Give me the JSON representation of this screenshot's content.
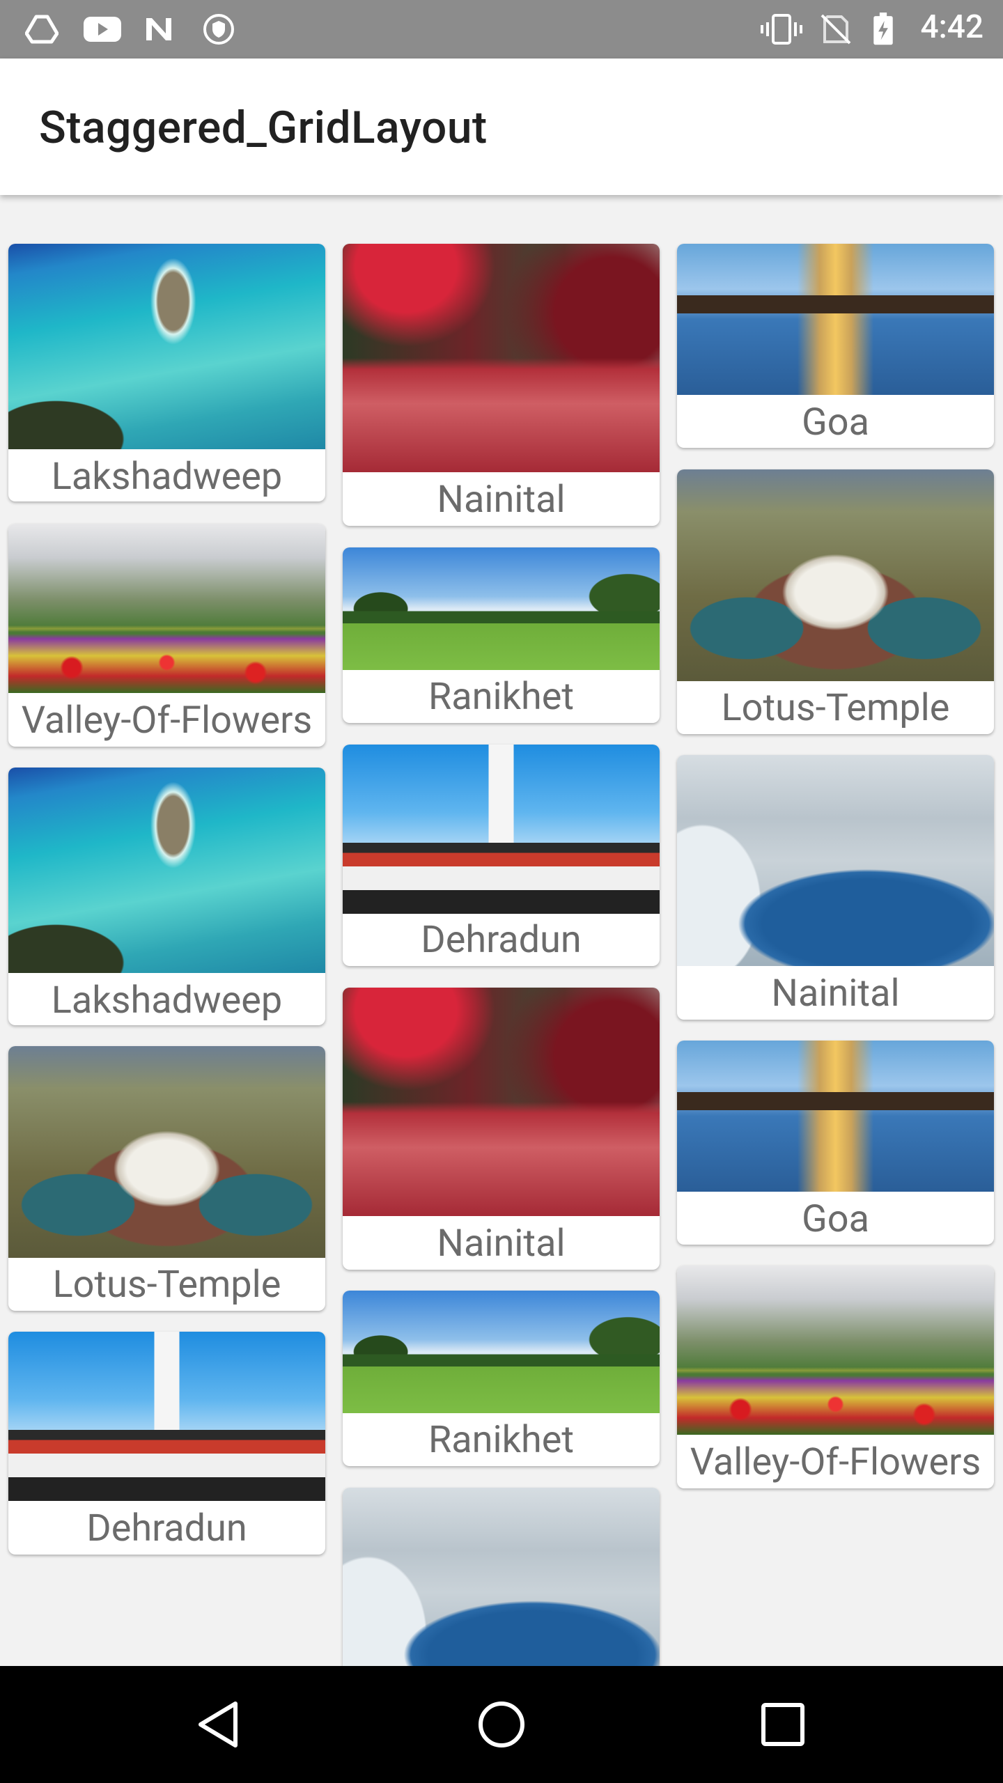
{
  "status_bar": {
    "time": "4:42",
    "left_icons": [
      "drive-icon",
      "youtube-icon",
      "n-app-icon",
      "shield-icon"
    ],
    "right_icons": [
      "vibrate-icon",
      "no-sim-icon",
      "battery-charging-icon"
    ]
  },
  "app_bar": {
    "title": "Staggered_GridLayout"
  },
  "grid": {
    "columns": [
      [
        {
          "label": "Lakshadweep",
          "image": "lakshadweep"
        },
        {
          "label": "Valley-Of-Flowers",
          "image": "valley"
        },
        {
          "label": "Lakshadweep",
          "image": "lakshadweep"
        },
        {
          "label": "Lotus-Temple",
          "image": "lotus"
        },
        {
          "label": "Dehradun",
          "image": "dehradun"
        }
      ],
      [
        {
          "label": "Nainital",
          "image": "nainital-red"
        },
        {
          "label": "Ranikhet",
          "image": "ranikhet"
        },
        {
          "label": "Dehradun",
          "image": "dehradun"
        },
        {
          "label": "Nainital",
          "image": "nainital-red"
        },
        {
          "label": "Ranikhet",
          "image": "ranikhet"
        },
        {
          "label": "",
          "image": "nainital-snow"
        }
      ],
      [
        {
          "label": "Goa",
          "image": "goa"
        },
        {
          "label": "Lotus-Temple",
          "image": "lotus"
        },
        {
          "label": "Nainital",
          "image": "nainital-snow"
        },
        {
          "label": "Goa",
          "image": "goa"
        },
        {
          "label": "Valley-Of-Flowers",
          "image": "valley"
        }
      ]
    ]
  },
  "nav_bar": {
    "icons": [
      "back-icon",
      "home-icon",
      "recents-icon"
    ]
  }
}
